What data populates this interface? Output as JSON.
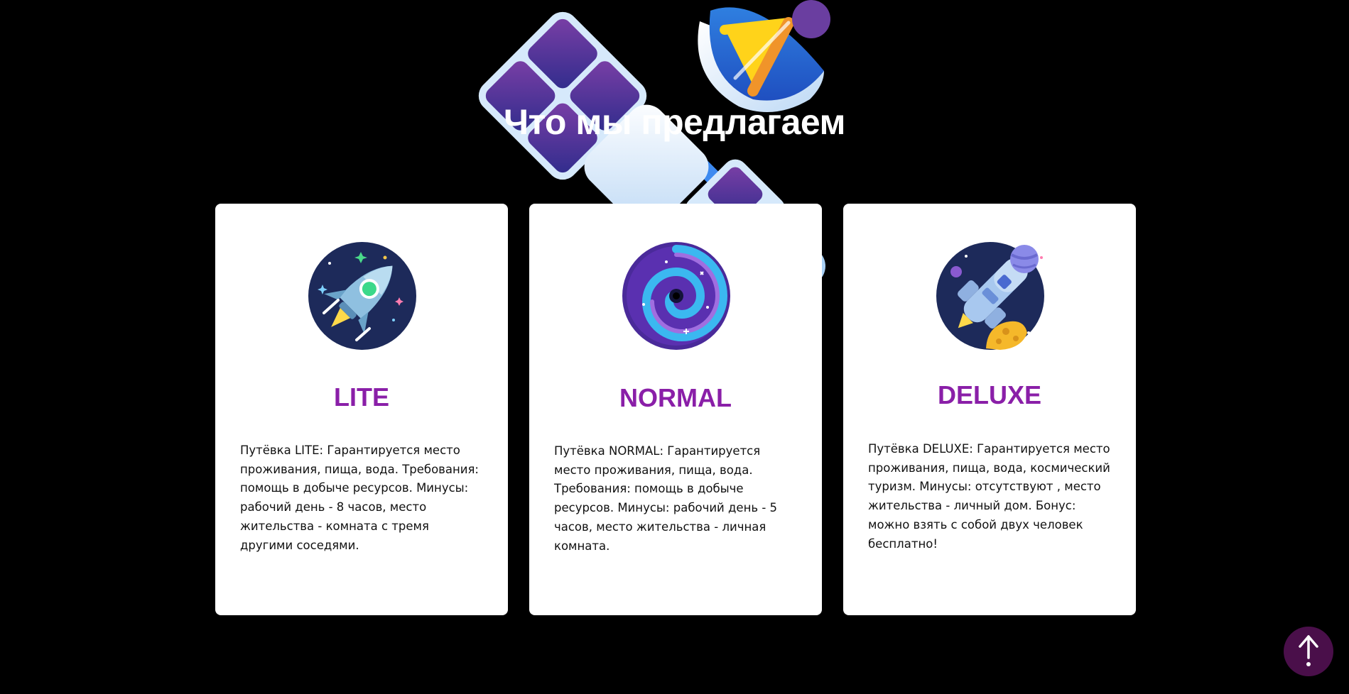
{
  "section": {
    "title": "Что мы предлагаем"
  },
  "cards": [
    {
      "name": "LITE",
      "icon": "rocket-icon",
      "description": "Путёвка LITE: Гарантируется место проживания, пища, вода. Требования: помощь в добыче ресурсов. Минусы: рабочий день - 8 часов, место жительства - комната с тремя другими соседями."
    },
    {
      "name": "NORMAL",
      "icon": "galaxy-icon",
      "description": "Путёвка NORMAL: Гарантируется место проживания, пища, вода. Требования: помощь в добыче ресурсов. Минусы: рабочий день - 5 часов, место жительства - личная комната."
    },
    {
      "name": "DELUXE",
      "icon": "spaceship-icon",
      "description": "Путёвка DELUXE: Гарантируется место проживания, пища, вода, космический туризм. Минусы: отсутствуют , место жительства - личный дом. Бонус: можно взять с собой двух человек бесплатно!"
    }
  ],
  "scroll_top": {
    "icon": "arrow-up-icon"
  },
  "colors": {
    "background": "#000000",
    "card": "#ffffff",
    "accent": "#8a1fa8",
    "scroll_button": "#4a0f4a"
  }
}
